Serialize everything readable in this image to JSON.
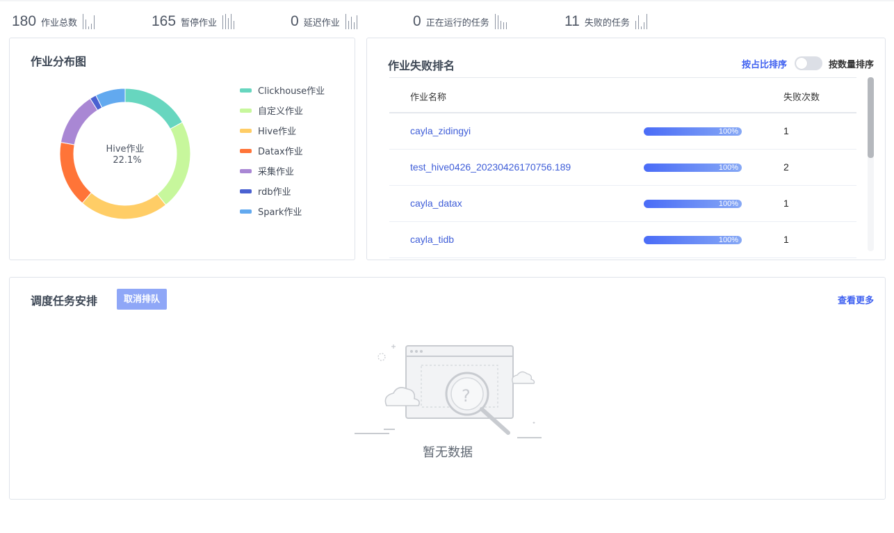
{
  "stats": [
    {
      "value": "180",
      "label": "作业总数"
    },
    {
      "value": "165",
      "label": "暂停作业"
    },
    {
      "value": "0",
      "label": "延迟作业"
    },
    {
      "value": "0",
      "label": "正在运行的任务"
    },
    {
      "value": "11",
      "label": "失败的任务"
    }
  ],
  "distribution": {
    "title": "作业分布图",
    "center_label": "Hive作业",
    "center_value": "22.1%"
  },
  "chart_data": {
    "type": "pie",
    "donut": true,
    "categories": [
      "Clickhouse作业",
      "自定义作业",
      "Hive作业",
      "Datax作业",
      "采集作业",
      "rdb作业",
      "Spark作业"
    ],
    "values": [
      17.0,
      22.3,
      22.1,
      16.4,
      13.2,
      1.6,
      7.4
    ],
    "colors": [
      "#67d6bf",
      "#c7f79c",
      "#ffcd66",
      "#ff7438",
      "#a987d4",
      "#4a61d1",
      "#62a9ef"
    ],
    "legend_position": "right"
  },
  "ranking": {
    "title": "作业失败排名",
    "toggle_left": "按占比排序",
    "toggle_right": "按数量排序",
    "col_name": "作业名称",
    "col_count": "失败次数",
    "rows": [
      {
        "name": "cayla_zidingyi",
        "percent": "100%",
        "count": "1"
      },
      {
        "name": "test_hive0426_20230426170756.189",
        "percent": "100%",
        "count": "2"
      },
      {
        "name": "cayla_datax",
        "percent": "100%",
        "count": "1"
      },
      {
        "name": "cayla_tidb",
        "percent": "100%",
        "count": "1"
      }
    ]
  },
  "schedule": {
    "title": "调度任务安排",
    "cancel_button": "取消排队",
    "more_link": "查看更多",
    "empty_text": "暂无数据"
  }
}
